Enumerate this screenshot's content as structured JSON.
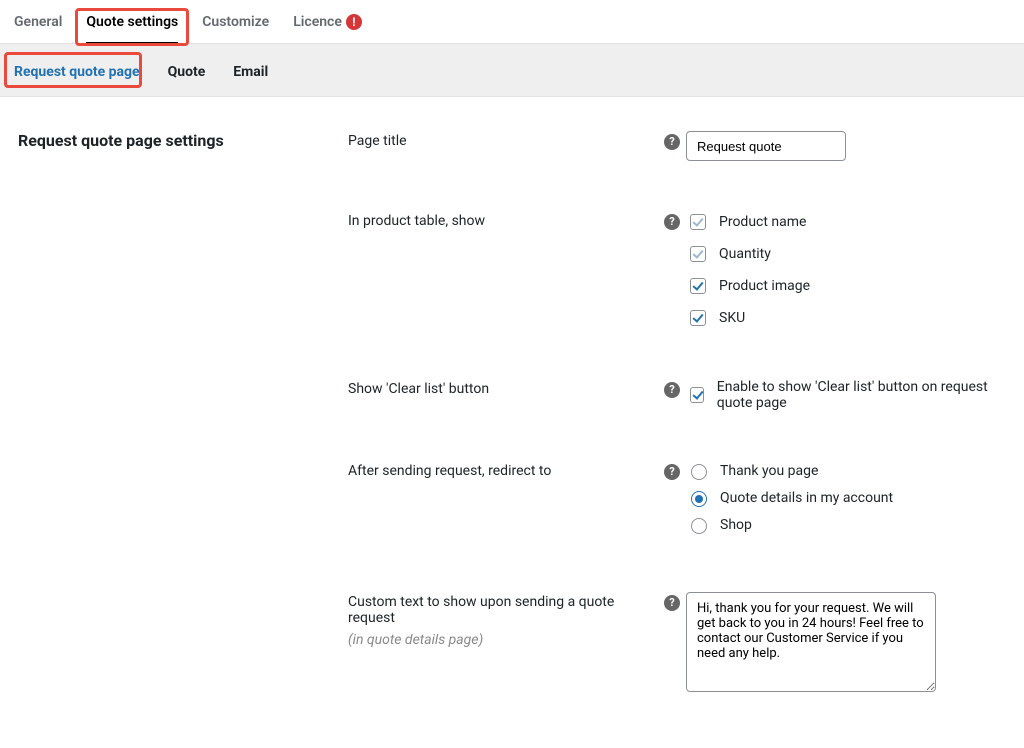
{
  "tabs": {
    "general": "General",
    "quote_settings": "Quote settings",
    "customize": "Customize",
    "licence": "Licence"
  },
  "subtabs": {
    "request_quote_page": "Request quote page",
    "quote": "Quote",
    "email": "Email"
  },
  "section": {
    "title": "Request quote page settings"
  },
  "fields": {
    "page_title": {
      "label": "Page title",
      "value": "Request quote"
    },
    "in_table_show": {
      "label": "In product table, show",
      "options": {
        "product_name": "Product name",
        "quantity": "Quantity",
        "product_image": "Product image",
        "sku": "SKU"
      }
    },
    "clear_list": {
      "label": "Show 'Clear list' button",
      "checkbox_label": "Enable to show 'Clear list' button on request quote page"
    },
    "redirect": {
      "label": "After sending request, redirect to",
      "options": {
        "thank_you": "Thank you page",
        "quote_details": "Quote details in my account",
        "shop": "Shop"
      }
    },
    "custom_text": {
      "label": "Custom text to show upon sending a quote request",
      "sublabel": "(in quote details page)",
      "value": "Hi, thank you for your request. We will get back to you in 24 hours! Feel free to contact our Customer Service if you need any help."
    }
  }
}
